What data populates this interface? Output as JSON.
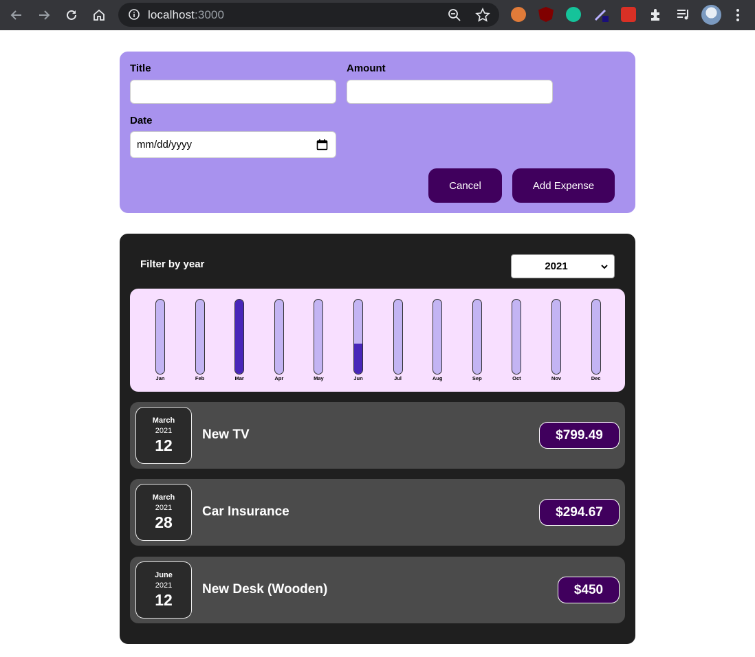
{
  "browser": {
    "url_host": "localhost",
    "url_port": ":3000"
  },
  "form": {
    "title_label": "Title",
    "amount_label": "Amount",
    "date_label": "Date",
    "title_value": "",
    "amount_value": "",
    "date_placeholder": "mm/dd/yyyy",
    "cancel_label": "Cancel",
    "add_label": "Add Expense"
  },
  "filter": {
    "label": "Filter by year",
    "selected_year": "2021"
  },
  "chart_data": {
    "type": "bar",
    "categories": [
      "Jan",
      "Feb",
      "Mar",
      "Apr",
      "May",
      "Jun",
      "Jul",
      "Aug",
      "Sep",
      "Oct",
      "Nov",
      "Dec"
    ],
    "values": [
      0,
      0,
      1094.16,
      0,
      0,
      450,
      0,
      0,
      0,
      0,
      0,
      0
    ],
    "ylim": [
      0,
      1094.16
    ],
    "grid": false
  },
  "expenses": [
    {
      "month": "March",
      "year": "2021",
      "day": "12",
      "title": "New TV",
      "amount": "$799.49"
    },
    {
      "month": "March",
      "year": "2021",
      "day": "28",
      "title": "Car Insurance",
      "amount": "$294.67"
    },
    {
      "month": "June",
      "year": "2021",
      "day": "12",
      "title": "New Desk (Wooden)",
      "amount": "$450"
    }
  ],
  "colors": {
    "form_bg": "#a892ee",
    "button_bg": "#40005d",
    "card_bg": "#1f1f1f",
    "chart_bg": "#f8dfff",
    "bar_track": "#c3b4f3",
    "bar_fill": "#4826b9",
    "item_bg": "#4b4b4b"
  }
}
